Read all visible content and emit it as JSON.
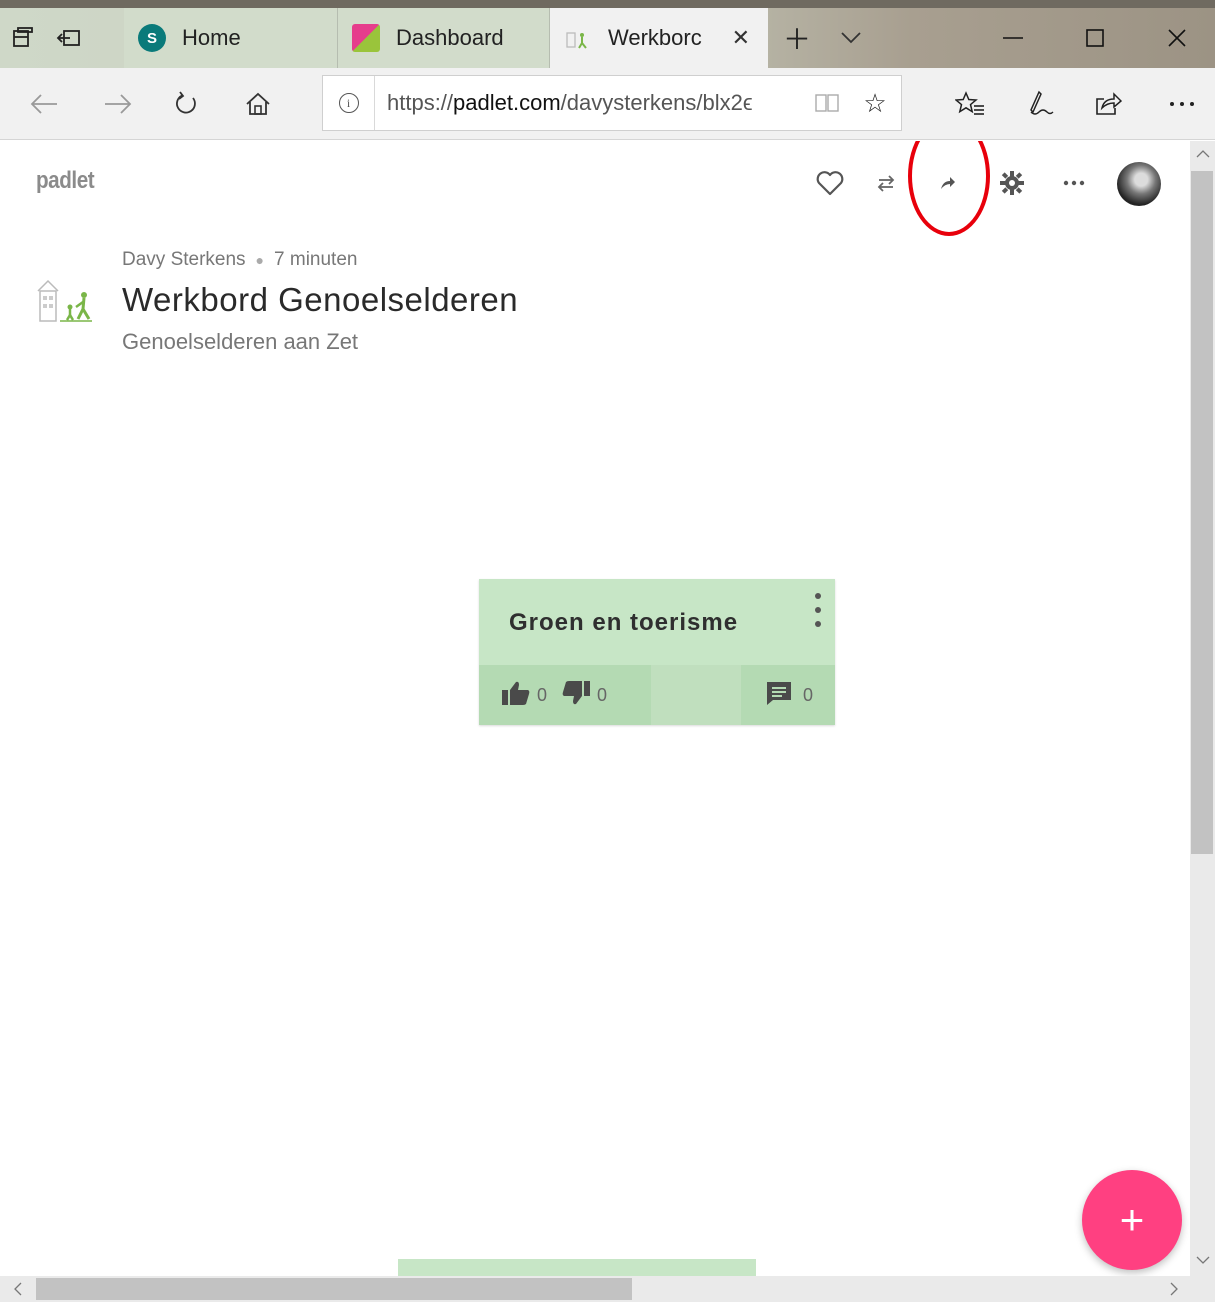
{
  "tabs": [
    {
      "label": "Home",
      "favicon": "S",
      "active": false
    },
    {
      "label": "Dashboard",
      "favicon": "",
      "active": false
    },
    {
      "label": "Werkborc",
      "favicon": "",
      "active": true
    }
  ],
  "address_bar": {
    "url_prefix": "https://",
    "url_host": "padlet.com",
    "url_path": "/davysterkens/blx2ϵ"
  },
  "padlet": {
    "brand": "padlet",
    "author": "Davy Sterkens",
    "time_ago": "7 minuten",
    "title": "Werkbord Genoelselderen",
    "subtitle": "Genoelselderen aan Zet"
  },
  "post": {
    "title": "Groen en toerisme",
    "likes": "0",
    "dislikes": "0",
    "comments": "0"
  },
  "fab_label": "+",
  "colors": {
    "accent": "#ff4081",
    "post_bg": "#c7e6c6",
    "highlight": "#e8000b"
  }
}
